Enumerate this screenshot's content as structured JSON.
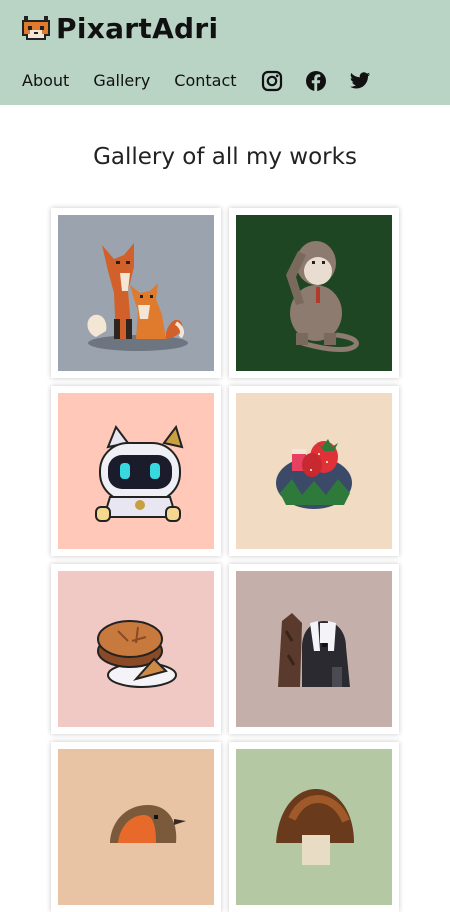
{
  "header": {
    "brand": "PixartAdri",
    "logo_icon": "fox-face-icon",
    "nav": {
      "about": "About",
      "gallery": "Gallery",
      "contact": "Contact"
    },
    "social_icons": [
      "instagram-icon",
      "facebook-icon",
      "twitter-icon"
    ]
  },
  "main": {
    "title": "Gallery of all my works"
  },
  "gallery": {
    "items": [
      {
        "subject": "foxes",
        "bg": "#9aa3ae"
      },
      {
        "subject": "monkey",
        "bg": "#1e4623"
      },
      {
        "subject": "robot-cat",
        "bg": "#ffc8b8"
      },
      {
        "subject": "strawberries",
        "bg": "#f1dcc3"
      },
      {
        "subject": "pie",
        "bg": "#f0c8c4"
      },
      {
        "subject": "badger",
        "bg": "#c4afaa"
      },
      {
        "subject": "robin",
        "bg": "#e8c4a4"
      },
      {
        "subject": "mushroom",
        "bg": "#b4c8a4"
      }
    ]
  }
}
